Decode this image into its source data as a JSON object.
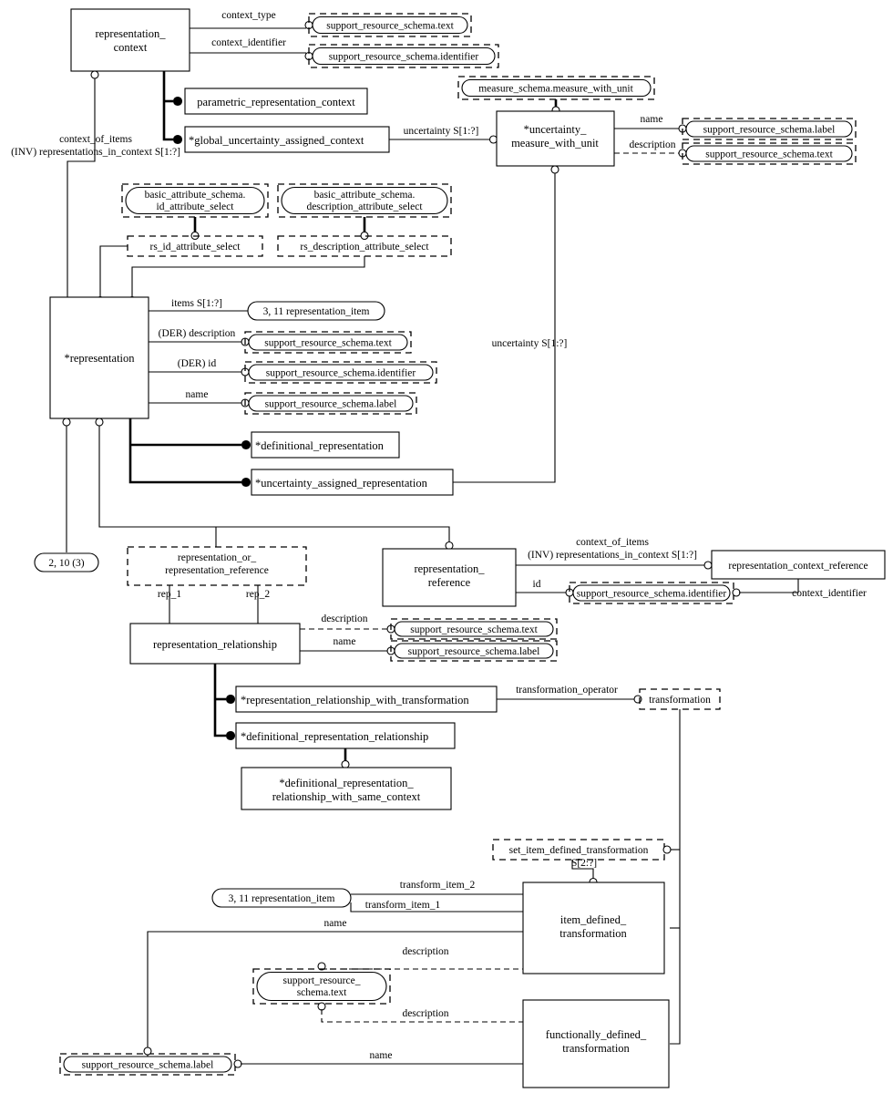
{
  "diagram": {
    "title": "EXPRESS-G entity-level diagram of representation_schema",
    "type": "express-g"
  },
  "entities": {
    "representation_context": "representation_\ncontext",
    "parametric_representation_context": "parametric_representation_context",
    "global_uncertainty_assigned_context": "*global_uncertainty_assigned_context",
    "uncertainty_measure_with_unit": "*uncertainty_\nmeasure_with_unit",
    "representation": "*representation",
    "definitional_representation": "*definitional_representation",
    "uncertainty_assigned_representation": "*uncertainty_assigned_representation",
    "representation_reference": "representation_\nreference",
    "representation_context_reference": "representation_context_reference",
    "representation_relationship": "representation_relationship",
    "representation_relationship_with_transformation": "*representation_relationship_with_transformation",
    "definitional_representation_relationship": "*definitional_representation_relationship",
    "definitional_representation_relationship_with_same_context": "*definitional_representation_\nrelationship_with_same_context",
    "item_defined_transformation": "item_defined_\ntransformation",
    "functionally_defined_transformation": "functionally_defined_\ntransformation"
  },
  "types": {
    "rs_id_attribute_select": "rs_id_attribute_select",
    "rs_description_attribute_select": "rs_description_attribute_select",
    "representation_or_representation_reference": "representation_or_\nrepresentation_reference",
    "transformation": "transformation",
    "set_item_defined_transformation": "set_item_defined_transformation",
    "set_item_defined_transformation_card": "S[2:?]"
  },
  "external_refs": {
    "srs_text_1": "support_resource_schema.text",
    "srs_identifier_1": "support_resource_schema.identifier",
    "measure_schema_measure_with_unit": "measure_schema.measure_with_unit",
    "srs_label_umwu": "support_resource_schema.label",
    "srs_text_umwu": "support_resource_schema.text",
    "bas_id_attribute_select": "basic_attribute_schema.\nid_attribute_select",
    "bas_description_attribute_select": "basic_attribute_schema.\ndescription_attribute_select",
    "rep_item_1": "3, 11 representation_item",
    "srs_text_rep": "support_resource_schema.text",
    "srs_identifier_rep": "support_resource_schema.identifier",
    "srs_label_rep": "support_resource_schema.label",
    "srs_identifier_ref": "support_resource_schema.identifier",
    "srs_text_rel": "support_resource_schema.text",
    "srs_label_rel": "support_resource_schema.label",
    "rep_item_2": "3, 11 representation_item",
    "srs_text_idt": "support_resource_\nschema.text",
    "srs_label_bottom": "support_resource_schema.label",
    "page_ref_2_10_3": "2, 10 (3)"
  },
  "attribute_labels": {
    "context_type": "context_type",
    "context_identifier": "context_identifier",
    "context_of_items": "context_of_items",
    "inv_representations_in_context": "(INV) representations_in_context S[1:?]",
    "uncertainty_top": "uncertainty S[1:?]",
    "uncertainty_mid": "uncertainty S[1:?]",
    "name_umwu": "name",
    "description_umwu": "description",
    "items": "items S[1:?]",
    "der_description": "(DER) description",
    "der_id": "(DER) id",
    "name_rep": "name",
    "rep_1": "rep_1",
    "rep_2": "rep_2",
    "description_rel": "description",
    "name_rel": "name",
    "context_of_items_ref": "context_of_items",
    "inv_representations_in_context_ref": "(INV) representations_in_context S[1:?]",
    "id_ref": "id",
    "context_identifier_ref": "context_identifier",
    "transformation_operator": "transformation_operator",
    "transform_item_2": "transform_item_2",
    "transform_item_1": "transform_item_1",
    "name_idt": "name",
    "description_idt": "description",
    "description_fdt": "description",
    "name_fdt": "name"
  },
  "colors": {
    "line": "#000000",
    "background": "#ffffff",
    "text": "#000000"
  }
}
